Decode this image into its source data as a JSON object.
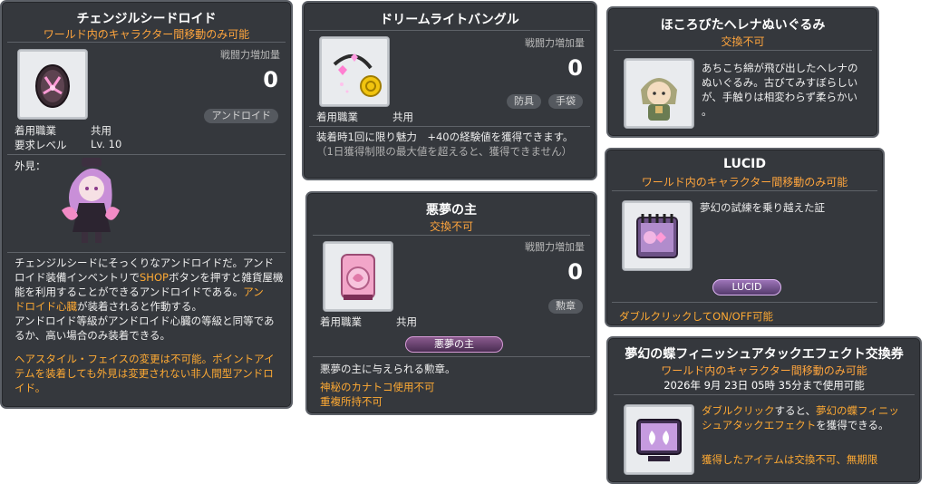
{
  "combat_power_label": "戦闘力増加量",
  "equip_job_label": "着用職業",
  "t1": {
    "title": "チェンジルシードロイド",
    "notice": "ワールド内のキャラクター間移動のみ可能",
    "cp_value": "0",
    "tag": "アンドロイド",
    "job": "共用",
    "req_label": "要求レベル",
    "req_value": "Lv. 10",
    "appearance_label": "外見：",
    "desc_a": "チェンジルシードにそっくりなアンドロイドだ。アンド",
    "desc_b_pre": "ロイド装備インベントリで",
    "desc_b_shop": "SHOP",
    "desc_b_post": "ボタンを押すと雑貨屋機",
    "desc_c_pre": "能を利用することができるアンドロイドである。",
    "desc_c_hl": "アン",
    "desc_d_hl": "ドロイド心臓",
    "desc_d_post": "が装着されると作動する。",
    "desc_e": "アンドロイド等級がアンドロイド心臓の等級と同等であ",
    "desc_f": "るか、高い場合のみ装着できる。",
    "warn_a": "ヘアスタイル・フェイスの変更は不可能。ポイントアイ",
    "warn_b": "テムを装着しても外見は変更されない非人間型アンドロ",
    "warn_c": "イド。",
    "accent": "#ffa53d"
  },
  "t2": {
    "title": "ドリームライトバングル",
    "cp_value": "0",
    "tag_a": "防具",
    "tag_b": "手袋",
    "job": "共用",
    "effect": "装着時1回に限り魅力　+40の経験値を獲得できます。",
    "limit": "（1日獲得制限の最大値を超えると、獲得できません）"
  },
  "t3": {
    "title": "ほころびたヘレナぬいぐるみ",
    "notice": "交換不可",
    "desc_a": "あちこち綿が飛び出したヘレナの",
    "desc_b": "ぬいぐるみ。古びてみすぼらしい",
    "desc_c": "が、手触りは相変わらず柔らかい",
    "desc_d": "。"
  },
  "t4": {
    "title": "悪夢の主",
    "notice": "交換不可",
    "cp_value": "0",
    "tag": "勲章",
    "job": "共用",
    "badge": "悪夢の主",
    "desc": "悪夢の主に与えられる勲章。",
    "note_a": "神秘のカナトコ使用不可",
    "note_b": "重複所持不可"
  },
  "t5": {
    "title": "LUCID",
    "notice": "ワールド内のキャラクター間移動のみ可能",
    "desc": "夢幻の試練を乗り越えた証",
    "badge": "LUCID",
    "dblclick": "ダブルクリックしてON/OFF可能"
  },
  "t6": {
    "title": "夢幻の蝶フィニッシュアタックエフェクト交換券",
    "notice": "ワールド内のキャラクター間移動のみ可能",
    "date": "2026年 9月 23日 05時 35分まで使用可能",
    "desc_a_pre": "ダブルクリック",
    "desc_a_mid": "すると、",
    "desc_a_hl": "夢幻の蝶フィニッ",
    "desc_b_hl": "シュアタックエフェクト",
    "desc_b_post": "を獲得できる。",
    "desc_c_pre": "獲得した",
    "desc_c_hl": "アイテムは交換不可、無期限"
  }
}
